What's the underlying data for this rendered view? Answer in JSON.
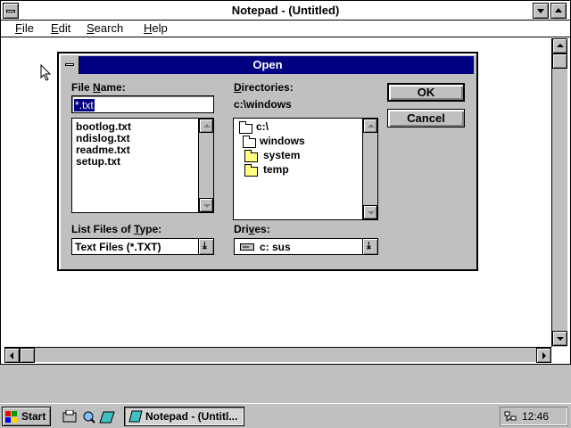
{
  "window": {
    "title": "Notepad - (Untitled)"
  },
  "menu": [
    {
      "prefix": "F",
      "rest": "ile"
    },
    {
      "prefix": "E",
      "rest": "dit"
    },
    {
      "prefix": "S",
      "rest": "earch"
    },
    {
      "prefix": "H",
      "rest": "elp"
    }
  ],
  "dialog": {
    "title": "Open",
    "file_name_label_a": "File ",
    "file_name_label_u": "N",
    "file_name_label_b": "ame:",
    "file_name_value": "*.txt",
    "files": [
      "bootlog.txt",
      "ndislog.txt",
      "readme.txt",
      "setup.txt"
    ],
    "directories_label_u": "D",
    "directories_label_b": "irectories:",
    "current_dir": "c:\\windows",
    "tree": [
      "c:\\",
      "windows",
      "system",
      "temp"
    ],
    "type_label_a": "List Files of ",
    "type_label_u": "T",
    "type_label_b": "ype:",
    "type_value": "Text Files (*.TXT)",
    "drives_label_a": "Dri",
    "drives_label_u": "v",
    "drives_label_b": "es:",
    "drive_value": "c: sus",
    "ok_label": "OK",
    "cancel_label": "Cancel",
    "title_color": "#000080"
  },
  "taskbar": {
    "start_label": "Start",
    "task_label": "Notepad - (Untitl...",
    "clock": "12:46 PM"
  },
  "icons": [
    "system-menu-icon",
    "minimize-icon",
    "maximize-icon",
    "folder-icon",
    "drive-icon",
    "mouse-cursor-icon",
    "windows-logo-icon",
    "quick-launch-icons"
  ]
}
